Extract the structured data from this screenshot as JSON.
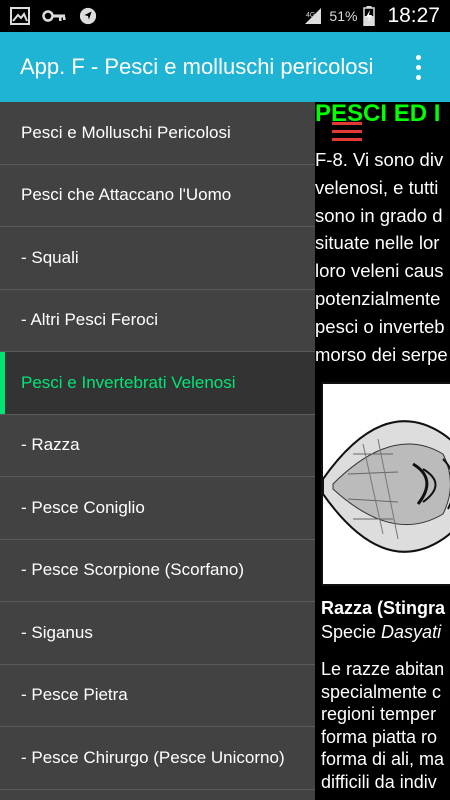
{
  "status_bar": {
    "icons": [
      "image-icon",
      "key-icon",
      "navigation-icon"
    ],
    "battery_percent": "51%",
    "time": "18:27"
  },
  "app_bar": {
    "title": "App. F - Pesci e molluschi pericolosi",
    "overflow_icon": "more-vert-icon"
  },
  "drawer": {
    "items": [
      {
        "label": "Pesci e Molluschi Pericolosi"
      },
      {
        "label": "Pesci che Attaccano l'Uomo"
      },
      {
        "label": "- Squali"
      },
      {
        "label": "- Altri Pesci Feroci"
      },
      {
        "label": "Pesci e Invertebrati Velenosi",
        "active": true
      },
      {
        "label": "- Razza"
      },
      {
        "label": "- Pesce Coniglio"
      },
      {
        "label": "- Pesce Scorpione (Scorfano)"
      },
      {
        "label": "- Siganus"
      },
      {
        "label": "- Pesce Pietra"
      },
      {
        "label": "- Pesce Chirurgo (Pesce Unicorno)"
      }
    ]
  },
  "content": {
    "title": "PESCI ED I",
    "paragraph_lines": [
      "F-8. Vi sono div",
      "velenosi, e tutti",
      "sono in grado d",
      "situate nelle lor",
      "loro veleni caus",
      "potenzialmente",
      "pesci o inverteb",
      "morso dei serpe"
    ],
    "caption_title": "Razza (Stingra",
    "caption_species_prefix": "Specie ",
    "caption_species_name": "Dasyati",
    "paragraph2_lines": [
      "Le razze abitan",
      "specialmente c",
      "regioni temper",
      "forma piatta ro",
      "forma di ali, ma",
      "difficili da indiv"
    ]
  },
  "colors": {
    "app_bar": "#1fb3d4",
    "drawer_bg": "#424242",
    "active_accent": "#00e676",
    "content_title": "#00ff00"
  }
}
